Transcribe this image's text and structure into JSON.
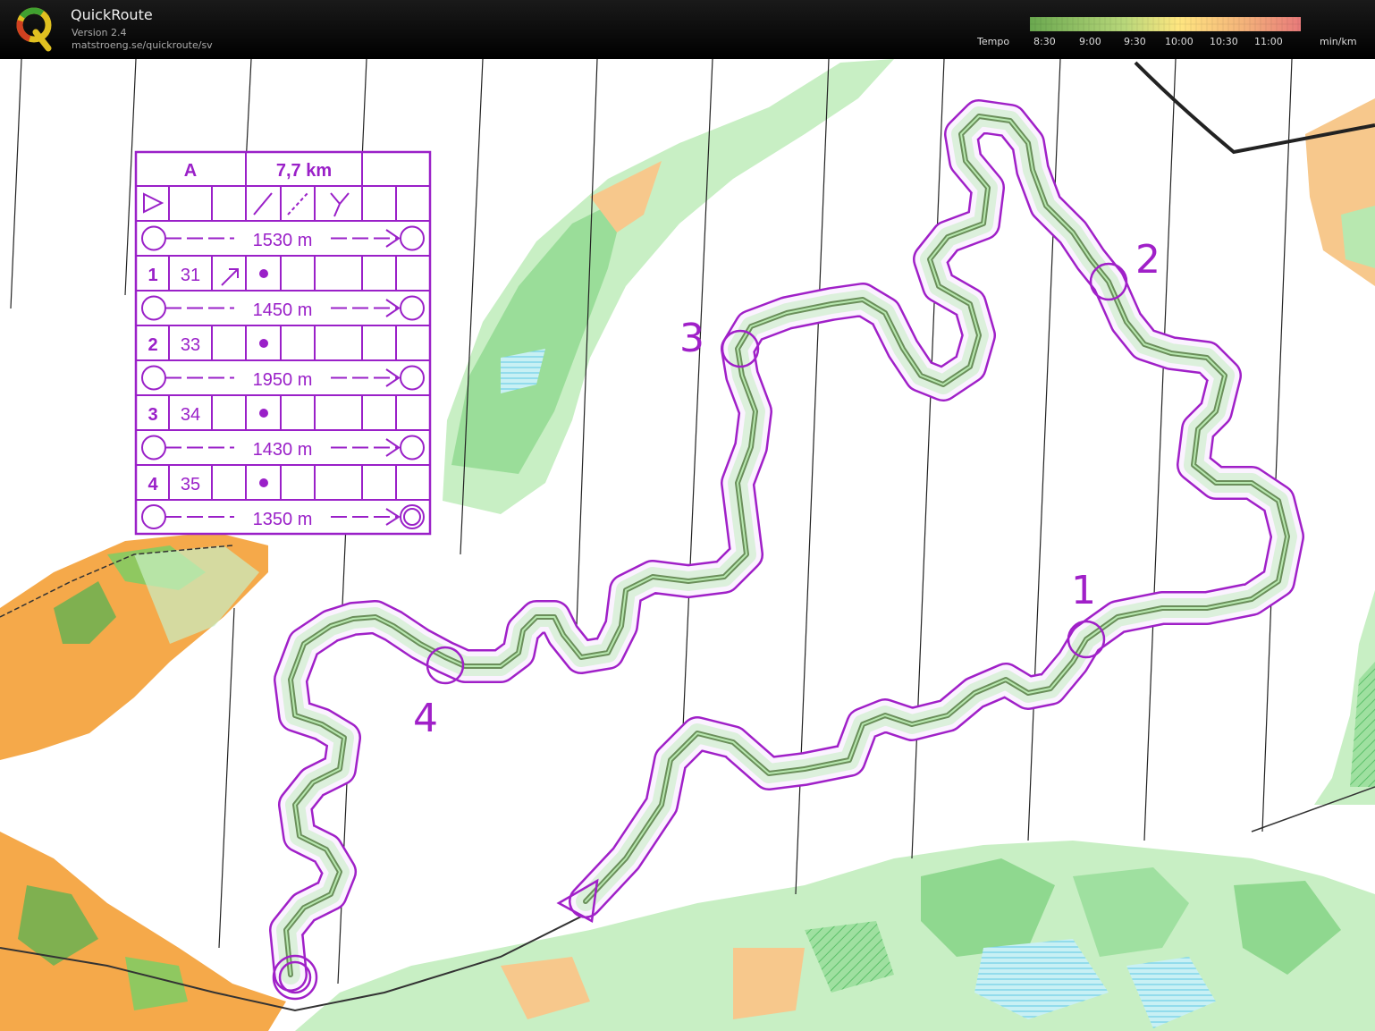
{
  "app": {
    "name": "QuickRoute",
    "version": "Version 2.4",
    "url": "matstroeng.se/quickroute/sv"
  },
  "tempo": {
    "label": "Tempo",
    "ticks": [
      "8:30",
      "9:00",
      "9:30",
      "10:00",
      "10:30",
      "11:00"
    ],
    "unit": "min/km",
    "colors": [
      "#6aa84f",
      "#ffe680",
      "#e87a7a"
    ]
  },
  "control_description": {
    "course": "A",
    "length": "7,7 km",
    "legs": [
      "1530 m",
      "1450 m",
      "1950 m",
      "1430 m",
      "1350 m"
    ],
    "controls": [
      {
        "num": "1",
        "code": "31"
      },
      {
        "num": "2",
        "code": "33"
      },
      {
        "num": "3",
        "code": "34"
      },
      {
        "num": "4",
        "code": "35"
      }
    ]
  },
  "map_labels": {
    "c1": "1",
    "c2": "2",
    "c3": "3",
    "c4": "4"
  },
  "colors": {
    "course_purple": "#a020c8",
    "forest_green": "#8fd88f",
    "open_yellow": "#f5a94a",
    "water_blue": "#7fd3ea"
  }
}
